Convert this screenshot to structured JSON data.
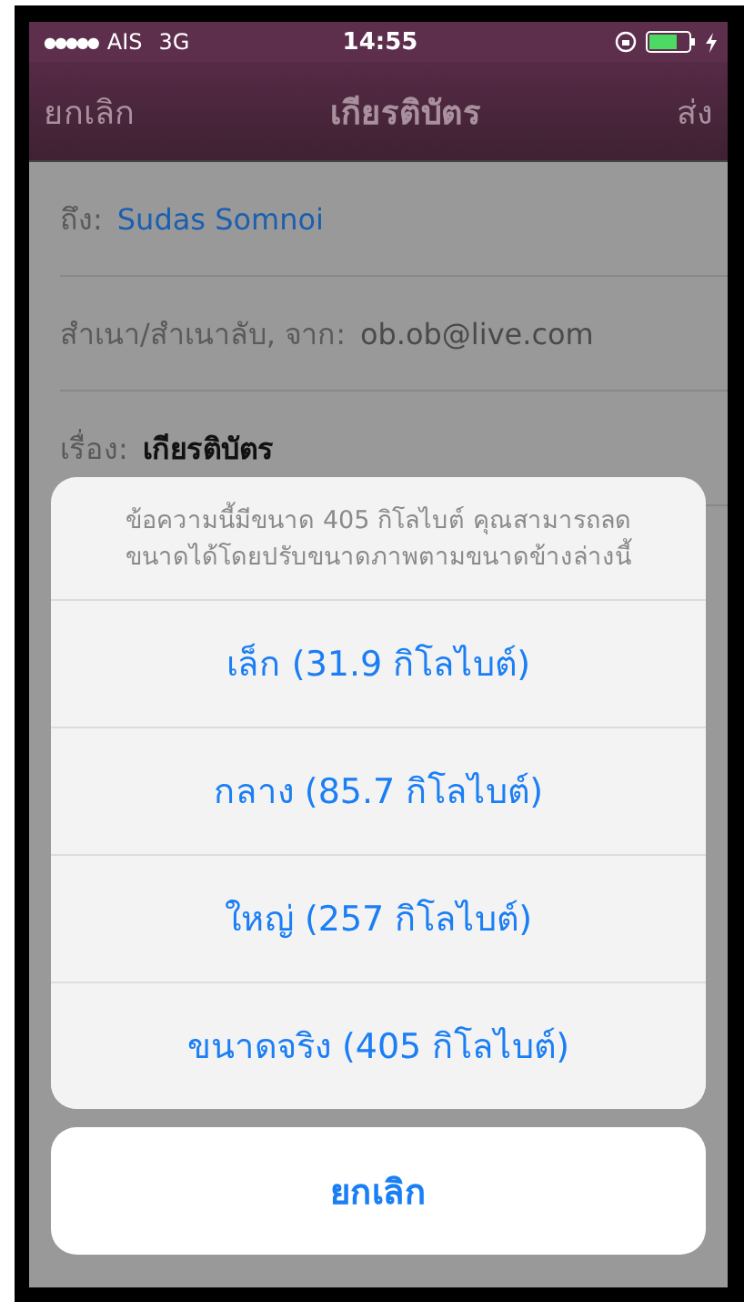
{
  "status_bar": {
    "signal": "●●●●●",
    "carrier": "AIS",
    "network": "3G",
    "time": "14:55"
  },
  "nav": {
    "cancel": "ยกเลิก",
    "title": "เกียรติบัตร",
    "send": "ส่ง"
  },
  "fields": [
    {
      "label": "ถึง:",
      "value": "Sudas Somnoi",
      "kind": "recipient"
    },
    {
      "label": "สำเนา/สำเนาลับ, จาก:",
      "value": "ob.ob@live.com",
      "kind": "plain"
    },
    {
      "label": "เรื่อง:",
      "value": "เกียรติบัตร",
      "kind": "subject"
    }
  ],
  "action_sheet": {
    "message": "ข้อความนี้มีขนาด 405 กิโลไบต์ คุณสามารถลด ขนาดได้โดยปรับขนาดภาพตามขนาดข้างล่างนี้",
    "options": [
      "เล็ก (31.9 กิโลไบต์)",
      "กลาง (85.7 กิโลไบต์)",
      "ใหญ่ (257 กิโลไบต์)",
      "ขนาดจริง (405 กิโลไบต์)"
    ],
    "cancel": "ยกเลิก"
  }
}
